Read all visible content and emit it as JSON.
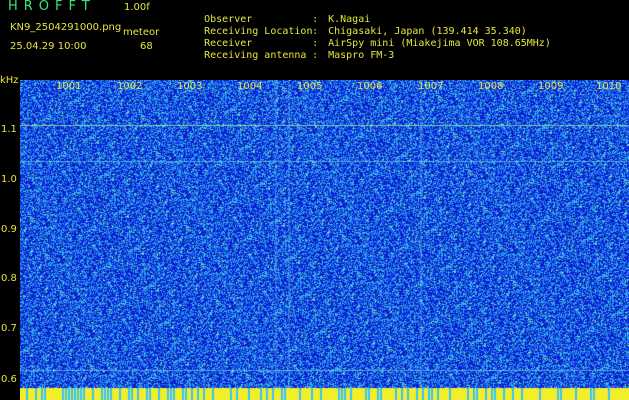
{
  "header": {
    "app_title": "HROFFT",
    "version": "1.00f",
    "filename": "KN9_2504291000.png",
    "meteor_label": "meteor",
    "datetime": "25.04.29 10:00",
    "meteor_count": "68"
  },
  "station": {
    "rows": [
      {
        "key": "Observer",
        "value": "K.Nagai"
      },
      {
        "key": "Receiving Location",
        "value": "Chigasaki, Japan (139.414 35.340)"
      },
      {
        "key": "Receiver",
        "value": "AirSpy mini (Miakejima VOR 108.65MHz)"
      },
      {
        "key": "Receiving antenna",
        "value": "Maspro FM-3"
      }
    ],
    "separator": ":"
  },
  "plot": {
    "y_unit": "kHz",
    "y_ticks": [
      "1.1",
      "1.0",
      "0.9",
      "0.8",
      "0.7",
      "0.6"
    ],
    "x_ticks": [
      "1001",
      "1002",
      "1003",
      "1004",
      "1005",
      "1006",
      "1007",
      "1008",
      "1009",
      "1010"
    ],
    "colors": {
      "background": "#1a2fd6",
      "noise_light": "#37c3ff",
      "noise_bright": "#9bf08a",
      "baseline": "#f2ee2a"
    }
  }
}
